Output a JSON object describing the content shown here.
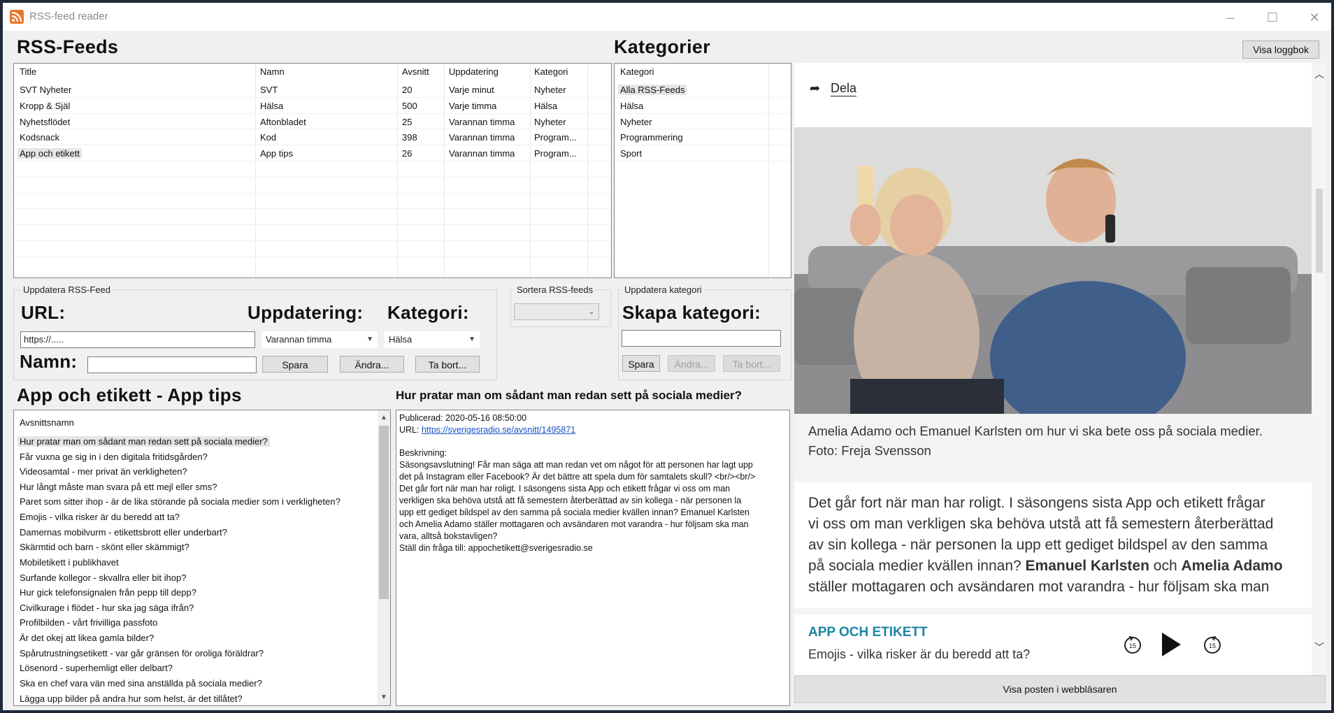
{
  "window": {
    "title": "RSS-feed reader",
    "min": "–",
    "max": "☐",
    "close": "✕"
  },
  "feeds": {
    "heading": "RSS-Feeds",
    "columns": [
      "Title",
      "Namn",
      "Avsnitt",
      "Uppdatering",
      "Kategori"
    ],
    "rows": [
      [
        "SVT Nyheter",
        "SVT",
        "20",
        "Varje minut",
        "Nyheter"
      ],
      [
        "Kropp & Själ",
        "Hälsa",
        "500",
        "Varje timma",
        "Hälsa"
      ],
      [
        "Nyhetsflödet",
        "Aftonbladet",
        "25",
        "Varannan timma",
        "Nyheter"
      ],
      [
        "Kodsnack",
        "Kod",
        "398",
        "Varannan timma",
        "Program..."
      ],
      [
        "App och etikett",
        "App tips",
        "26",
        "Varannan timma",
        "Program..."
      ]
    ]
  },
  "categories": {
    "heading": "Kategorier",
    "column": "Kategori",
    "items": [
      "Alla RSS-Feeds",
      "Hälsa",
      "Nyheter",
      "Programmering",
      "Sport"
    ]
  },
  "log_button": "Visa loggbok",
  "update_feed": {
    "group_label": "Uppdatera RSS-Feed",
    "url_label": "URL:",
    "update_label": "Uppdatering:",
    "category_label": "Kategori:",
    "url_value": "https://.....",
    "update_value": "Varannan timma",
    "category_value": "Hälsa",
    "name_label": "Namn:",
    "name_value": "",
    "save": "Spara",
    "change": "Ändra...",
    "delete": "Ta bort..."
  },
  "sort": {
    "label": "Sortera RSS-feeds",
    "value": ""
  },
  "update_category": {
    "group_label": "Uppdatera kategori",
    "create_label": "Skapa kategori:",
    "value": "",
    "save": "Spara",
    "change": "Ändra...",
    "delete": "Ta bort..."
  },
  "episodes": {
    "heading": "App och etikett - App tips",
    "column": "Avsnittsnamn",
    "items": [
      "Hur pratar man om sådant man redan sett på sociala medier?",
      "Får vuxna ge sig in i den digitala fritidsgården?",
      "Videosamtal - mer privat än verkligheten?",
      "Hur långt måste man svara på ett mejl eller sms?",
      "Paret som sitter ihop - är de lika störande på sociala medier som i verkligheten?",
      "Emojis - vilka risker är du beredd att ta?",
      "Damernas mobilvurm - etikettsbrott eller underbart?",
      "Skärmtid och barn - skönt eller skämmigt?",
      "Mobiletikett i publikhavet",
      "Surfande kollegor - skvallra eller bit ihop?",
      "Hur gick telefonsignalen från pepp till depp?",
      "Civilkurage i flödet - hur ska jag säga ifrån?",
      "Profilbilden - vårt frivilliga passfoto",
      "Är det okej att likea gamla bilder?",
      "Spårutrustningsetikett - var går gränsen för oroliga föräldrar?",
      "Lösenord - superhemligt eller delbart?",
      "Ska en chef vara vän med sina anställda på sociala medier?",
      "Lägga upp bilder på andra hur som helst, är det tillåtet?"
    ]
  },
  "detail": {
    "title": "Hur pratar man om sådant man redan sett på sociala medier?",
    "published": "Publicerad: 2020-05-16 08:50:00",
    "url_prefix": "URL: ",
    "url": "https://sverigesradio.se/avsnitt/1495871",
    "desc_label": "Beskrivning:",
    "desc_lines": [
      "Säsongsavslutning! Får man säga att man redan vet om något för att personen har lagt upp",
      "det på Instagram eller Facebook? Är det bättre att spela dum för samtalets skull? <br/><br/>",
      "Det går fort när man har roligt. I säsongens sista App och etikett frågar vi oss om man",
      "verkligen ska behöva utstå att få semestern återberättad av sin kollega - när personen la",
      "upp ett gediget bildspel av den samma på sociala medier kvällen innan? Emanuel Karlsten",
      "och Amelia Adamo ställer mottagaren och avsändaren mot varandra - hur följsam ska man",
      "vara, alltså bokstavligen?",
      "Ställ din fråga till: appochetikett@sverigesradio.se"
    ]
  },
  "web": {
    "share": "Dela",
    "caption_lines": [
      "Amelia Adamo och Emanuel Karlsten om hur vi ska bete oss på sociala medier.",
      "Foto: Freja Svensson"
    ],
    "article": {
      "line1": "Det går fort när man har roligt. I säsongens sista App och etikett frågar",
      "line2": "vi oss om man verkligen ska behöva utstå att få semestern återberättad",
      "line3": "av sin kollega - när personen la upp ett gediget bildspel av den samma",
      "line4_pre": "på sociala medier kvällen innan? ",
      "line4_b1": "Emanuel Karlsten",
      "line4_mid": " och ",
      "line4_b2": "Amelia Adamo",
      "line5": "ställer mottagaren och avsändaren mot varandra - hur följsam ska man"
    },
    "program": "APP OCH ETIKETT",
    "episode": "Emojis - vilka risker är du beredd att ta?"
  },
  "open_browser": "Visa posten i webbläsaren"
}
